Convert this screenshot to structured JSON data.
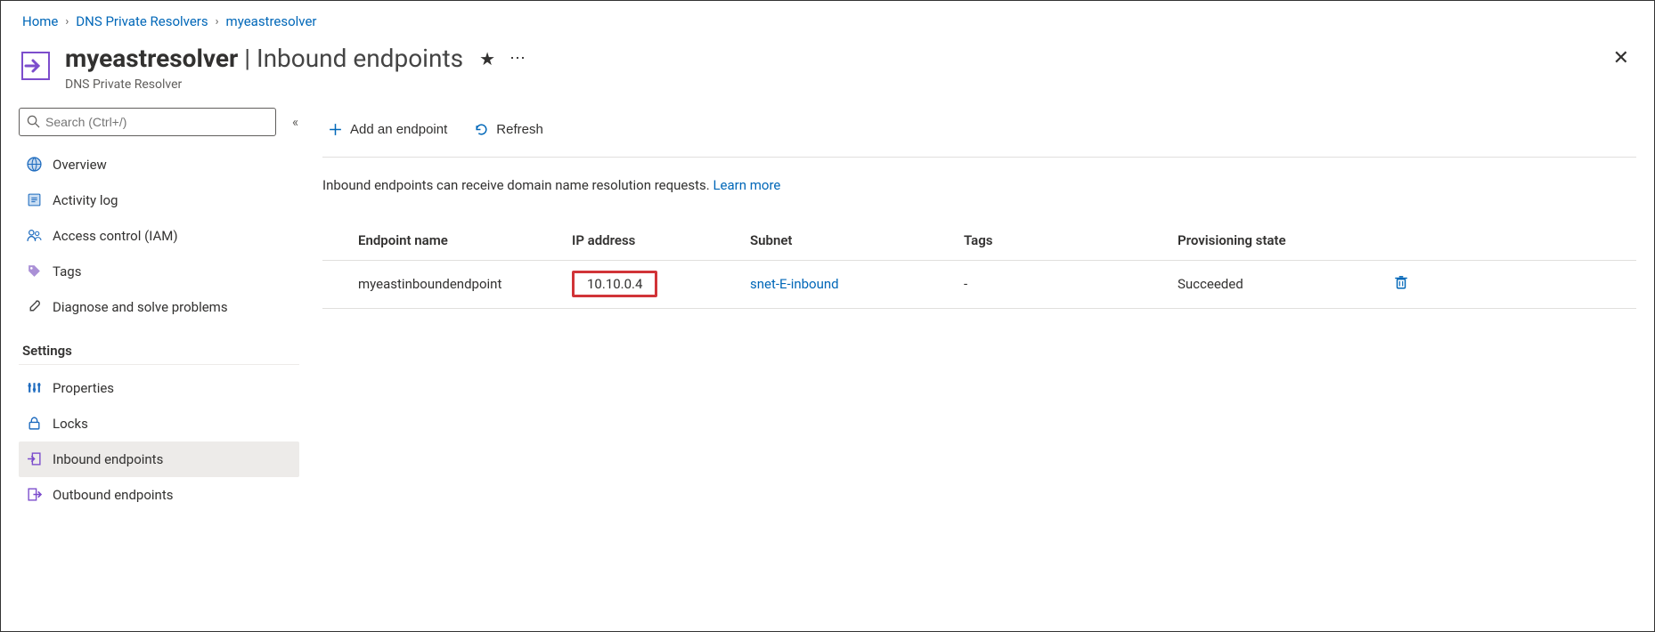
{
  "breadcrumb": [
    {
      "label": "Home"
    },
    {
      "label": "DNS Private Resolvers"
    },
    {
      "label": "myeastresolver"
    }
  ],
  "header": {
    "title_bold": "myeastresolver",
    "title_light": "Inbound endpoints",
    "subtitle": "DNS Private Resolver"
  },
  "search": {
    "placeholder": "Search (Ctrl+/)"
  },
  "sidebar": {
    "items": [
      {
        "label": "Overview",
        "icon": "globe",
        "selected": false
      },
      {
        "label": "Activity log",
        "icon": "log",
        "selected": false
      },
      {
        "label": "Access control (IAM)",
        "icon": "people",
        "selected": false
      },
      {
        "label": "Tags",
        "icon": "tag",
        "selected": false
      },
      {
        "label": "Diagnose and solve problems",
        "icon": "wrench",
        "selected": false
      }
    ],
    "section_label": "Settings",
    "settings_items": [
      {
        "label": "Properties",
        "icon": "properties",
        "selected": false
      },
      {
        "label": "Locks",
        "icon": "lock",
        "selected": false
      },
      {
        "label": "Inbound endpoints",
        "icon": "inbound",
        "selected": true
      },
      {
        "label": "Outbound endpoints",
        "icon": "outbound",
        "selected": false
      }
    ]
  },
  "toolbar": {
    "add_label": "Add an endpoint",
    "refresh_label": "Refresh"
  },
  "description": {
    "text": "Inbound endpoints can receive domain name resolution requests. ",
    "learn_more": "Learn more"
  },
  "table": {
    "headers": {
      "name": "Endpoint name",
      "ip": "IP address",
      "subnet": "Subnet",
      "tags": "Tags",
      "state": "Provisioning state"
    },
    "rows": [
      {
        "name": "myeastinboundendpoint",
        "ip": "10.10.0.4",
        "subnet": "snet-E-inbound",
        "tags": "-",
        "state": "Succeeded"
      }
    ]
  }
}
